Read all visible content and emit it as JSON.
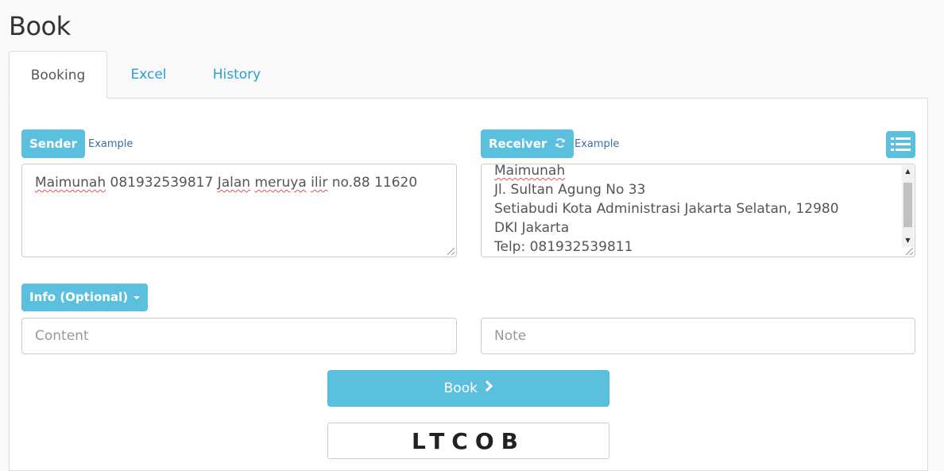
{
  "page": {
    "title": "Book"
  },
  "tabs": [
    {
      "label": "Booking",
      "active": true
    },
    {
      "label": "Excel",
      "active": false
    },
    {
      "label": "History",
      "active": false
    }
  ],
  "sender": {
    "label": "Sender",
    "example_link": "Example",
    "value": "Maimunah 081932539817 Jalan meruya ilir no.88 11620"
  },
  "receiver": {
    "label": "Receiver",
    "example_link": "Example",
    "lines": [
      "Maimunah",
      "Jl. Sultan Agung No 33",
      "Setiabudi Kota Administrasi Jakarta Selatan, 12980",
      "DKI Jakarta",
      "Telp: 081932539811"
    ]
  },
  "info": {
    "label": "Info (Optional)",
    "content_placeholder": "Content",
    "note_placeholder": "Note"
  },
  "book_button": {
    "label": "Book"
  },
  "captcha": {
    "text": "LTCOB"
  },
  "colors": {
    "accent": "#5bc0de",
    "link": "#2a9fd6"
  }
}
